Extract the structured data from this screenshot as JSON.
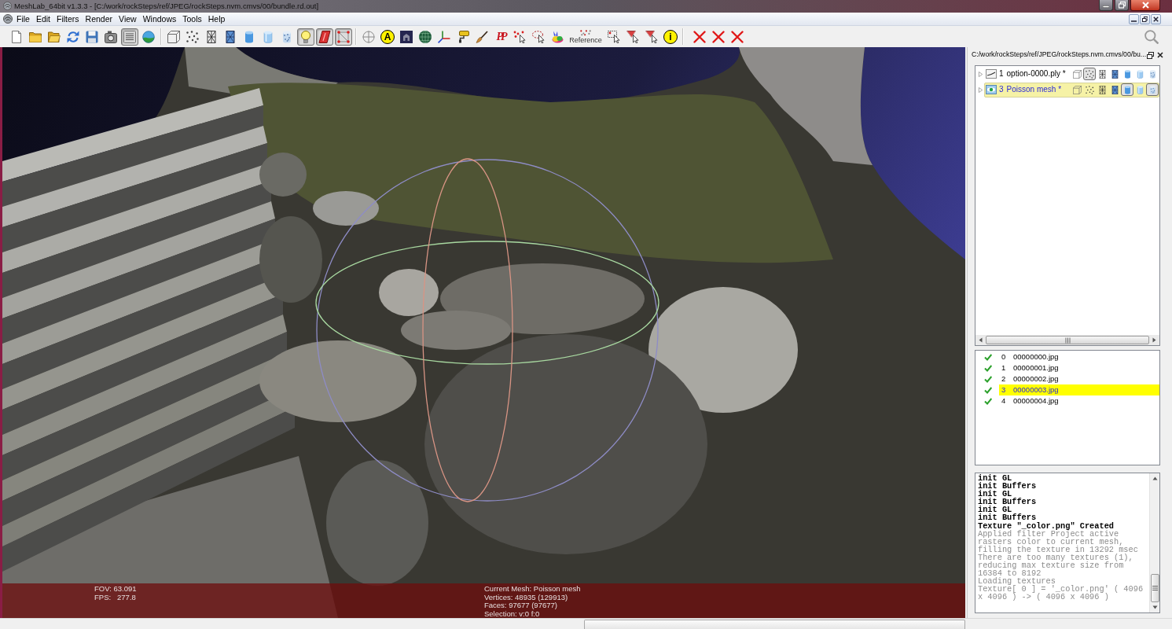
{
  "window": {
    "title": "MeshLab_64bit v1.3.3 - [C:/work/rockSteps/ref/JPEG/rockSteps.nvm.cmvs/00/bundle.rd.out]"
  },
  "menu": [
    "File",
    "Edit",
    "Filters",
    "Render",
    "View",
    "Windows",
    "Tools",
    "Help"
  ],
  "toolbar": {
    "groups": [
      [
        {
          "kind": "icon",
          "pressed": false
        },
        {
          "kind": "icon",
          "pressed": false
        },
        {
          "kind": "icon",
          "pressed": false
        },
        {
          "kind": "icon",
          "pressed": false
        },
        {
          "kind": "icon",
          "pressed": false
        },
        {
          "kind": "icon",
          "pressed": false
        },
        {
          "kind": "icon",
          "pressed": true
        },
        {
          "kind": "icon",
          "pressed": false
        }
      ],
      [
        {
          "kind": "icon",
          "pressed": false
        },
        {
          "kind": "icon",
          "pressed": false
        },
        {
          "kind": "icon",
          "pressed": false
        },
        {
          "kind": "icon",
          "pressed": false
        },
        {
          "kind": "icon",
          "pressed": false
        },
        {
          "kind": "icon",
          "pressed": false
        },
        {
          "kind": "icon",
          "pressed": false
        },
        {
          "kind": "icon",
          "pressed": true
        },
        {
          "kind": "icon",
          "pressed": true
        },
        {
          "kind": "icon",
          "pressed": true
        }
      ],
      [
        {
          "kind": "icon",
          "pressed": false
        },
        {
          "kind": "letter",
          "glyph": "A",
          "pressed": false
        },
        {
          "kind": "icon",
          "pressed": false
        },
        {
          "kind": "icon",
          "pressed": false
        },
        {
          "kind": "icon",
          "pressed": false
        },
        {
          "kind": "icon",
          "pressed": false
        },
        {
          "kind": "icon",
          "pressed": false
        },
        {
          "kind": "logo",
          "glyph": "PP",
          "pressed": false
        },
        {
          "kind": "icon",
          "pressed": false
        },
        {
          "kind": "icon",
          "pressed": false
        },
        {
          "kind": "icon",
          "pressed": false
        },
        {
          "kind": "captioned",
          "caption": "Reference",
          "pressed": false
        },
        {
          "kind": "icon",
          "pressed": false
        },
        {
          "kind": "icon",
          "pressed": false
        },
        {
          "kind": "icon",
          "pressed": false
        },
        {
          "kind": "letter",
          "glyph": "i",
          "pressed": false
        }
      ],
      [
        {
          "kind": "icon",
          "pressed": false
        },
        {
          "kind": "icon",
          "pressed": false
        },
        {
          "kind": "icon",
          "pressed": false
        }
      ]
    ]
  },
  "viewport": {
    "info_left": [
      "FOV: 63.091",
      "FPS:   277.8"
    ],
    "info_right": [
      "Current Mesh: Poisson mesh",
      "Vertices: 48935 (129913)",
      "Faces: 97677 (97677)",
      "Selection: v:0 f:0"
    ]
  },
  "layer_panel": {
    "title": "C:/work/rockSteps/ref/JPEG/rockSteps.nvm.cmvs/00/bu...",
    "layers": [
      {
        "index": "1",
        "name": "option-0000.ply *",
        "expanded": false,
        "visible": false,
        "selected": false,
        "modes": [
          {
            "pressed": false
          },
          {
            "pressed": true
          },
          {
            "pressed": false
          },
          {
            "pressed": false
          },
          {
            "pressed": false
          },
          {
            "pressed": false
          },
          {
            "pressed": false
          }
        ]
      },
      {
        "index": "3",
        "name": "Poisson mesh *",
        "expanded": false,
        "visible": true,
        "selected": true,
        "modes": [
          {
            "pressed": false
          },
          {
            "pressed": false
          },
          {
            "pressed": false
          },
          {
            "pressed": false
          },
          {
            "pressed": true
          },
          {
            "pressed": false
          },
          {
            "pressed": true
          }
        ]
      }
    ],
    "rasters": [
      {
        "index": "0",
        "name": "00000000.jpg",
        "visible": true,
        "selected": false
      },
      {
        "index": "1",
        "name": "00000001.jpg",
        "visible": true,
        "selected": false
      },
      {
        "index": "2",
        "name": "00000002.jpg",
        "visible": true,
        "selected": false
      },
      {
        "index": "3",
        "name": "00000003.jpg",
        "visible": true,
        "selected": true
      },
      {
        "index": "4",
        "name": "00000004.jpg",
        "visible": true,
        "selected": false
      }
    ],
    "log": [
      {
        "kind": "bold",
        "text": "init GL"
      },
      {
        "kind": "bold",
        "text": "init Buffers"
      },
      {
        "kind": "bold",
        "text": "init GL"
      },
      {
        "kind": "bold",
        "text": "init Buffers"
      },
      {
        "kind": "bold",
        "text": "init GL"
      },
      {
        "kind": "bold",
        "text": "init Buffers"
      },
      {
        "kind": "bold",
        "text": "Texture \"_color.png\" Created"
      },
      {
        "kind": "plain",
        "text": "Applied filter Project active rasters color to current mesh, filling the texture in 13292 msec"
      },
      {
        "kind": "plain",
        "text": "There are too many textures (1), reducing max texture size from 16384 to 8192"
      },
      {
        "kind": "plain",
        "text": "Loading textures"
      },
      {
        "kind": "plain",
        "text": "Texture[ 0 ] = '_color.png' ( 4096 x 4096 ) -> ( 4096 x 4096 )"
      }
    ]
  }
}
